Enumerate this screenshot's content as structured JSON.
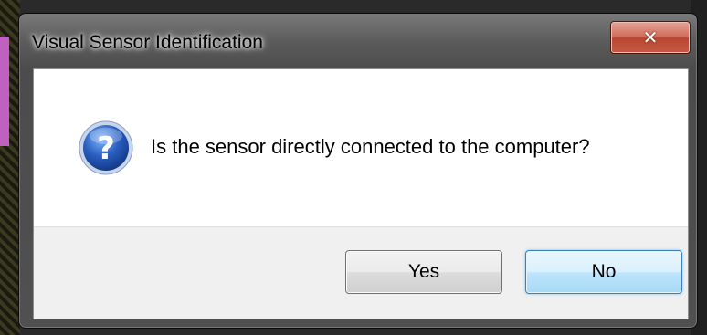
{
  "dialog": {
    "title": "Visual Sensor Identification",
    "message": "Is the sensor directly connected to the computer?",
    "icon": "question-icon",
    "close_glyph": "✕",
    "buttons": {
      "yes_label": "Yes",
      "no_label": "No"
    },
    "default_button": "No"
  },
  "colors": {
    "close_button": "#c65a44",
    "question_icon": "#2a5fc0",
    "default_button_border": "#3c7fb1"
  }
}
